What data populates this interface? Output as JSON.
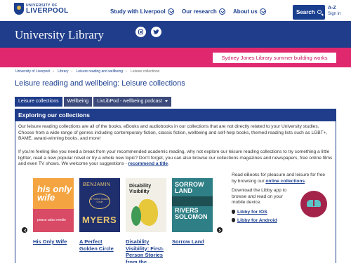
{
  "header": {
    "logo_small": "UNIVERSITY OF",
    "logo_big": "LIVERPOOL",
    "nav": [
      "Study with Liverpool",
      "Our research",
      "About us"
    ],
    "search_label": "Search",
    "az_label": "A-Z",
    "signin_label": "Sign in"
  },
  "banner": {
    "title": "University Library",
    "social_icons": [
      "instagram-icon",
      "twitter-icon"
    ]
  },
  "notice": {
    "label": "Sydney Jones Library summer building works"
  },
  "breadcrumb": [
    "University of Liverpool",
    "Library",
    "Leisure reading and wellbeing",
    "Leisure collections"
  ],
  "page_title": "Leisure reading and wellbeing: Leisure collections",
  "tabs": [
    "Leisure collections",
    "Wellbeing",
    "LivLibPod - wellbeing podcast"
  ],
  "section": {
    "heading": "Exploring our collections",
    "p1": "Our leisure reading collections are all of the books, eBooks and audiobooks in our collections that are not directly related to your University studies. Choose from a wide range of genres including contemporary fiction, classic fiction, wellbeing and self-help books, themed reading lists such as LGBT+, BAME, award-winning books, and more!",
    "p2": "If you're feeling like you need a break from your recommended academic reading, why not explore our leisure reading collections to try something a little lighter, read a new popular novel or try a whole new topic? Don't forget, you can also browse our collections magazines and newspapers, free online films and even TV shows. We welcome your suggestions -",
    "p2_link": "recommend a title",
    "p2_end": "."
  },
  "books": [
    {
      "title": "His Only Wife",
      "cover_text": "his only wife",
      "cover_author": "peace adzo medie"
    },
    {
      "title": "A Perfect Golden Circle",
      "cover_text": "BENJAMIN",
      "cover_sub": "A Perfect Golden Circle",
      "cover_text2": "MYERS"
    },
    {
      "title": "Disability Visibility: First-Person Stories from the...",
      "cover_text": "Disability Visibility"
    },
    {
      "title": "Sorrow Land",
      "cover_text": "SORROW LAND",
      "cover_text2": "RIVERS SOLOMON"
    }
  ],
  "libby": {
    "p1": "Read eBooks for pleasure and leisure for free by browsing our",
    "p1_link": "online collections",
    "p1_end": ".",
    "p2": "Download the Libby app to browse and read on your mobile device.",
    "ios": "Libby for IOS",
    "android": "Libby for Android"
  },
  "colors": {
    "primary": "#1f3d8a",
    "accent_pink": "#e0286e"
  }
}
